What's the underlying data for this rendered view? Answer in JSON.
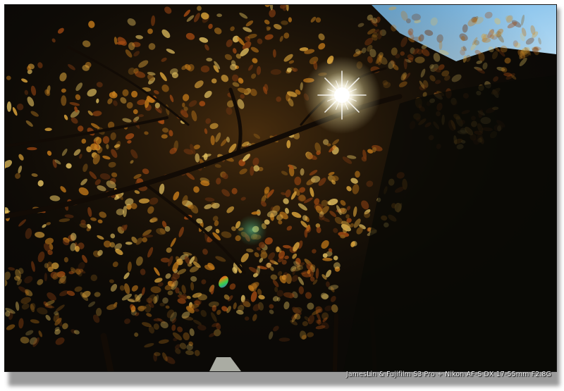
{
  "photo": {
    "subject": "autumn-forest-canopy-backlit",
    "sky_color": "#8fc6ea",
    "sun_color": "#ffffff",
    "foliage_colors": [
      "#c47a1a",
      "#a34a12",
      "#d9a23a",
      "#6e3410",
      "#e3c060",
      "#8a5a18"
    ]
  },
  "caption": {
    "text": "JamesLin & Fujifilm S3 Pro + Nikon AF-S DX 17-55mm F2.8G"
  }
}
